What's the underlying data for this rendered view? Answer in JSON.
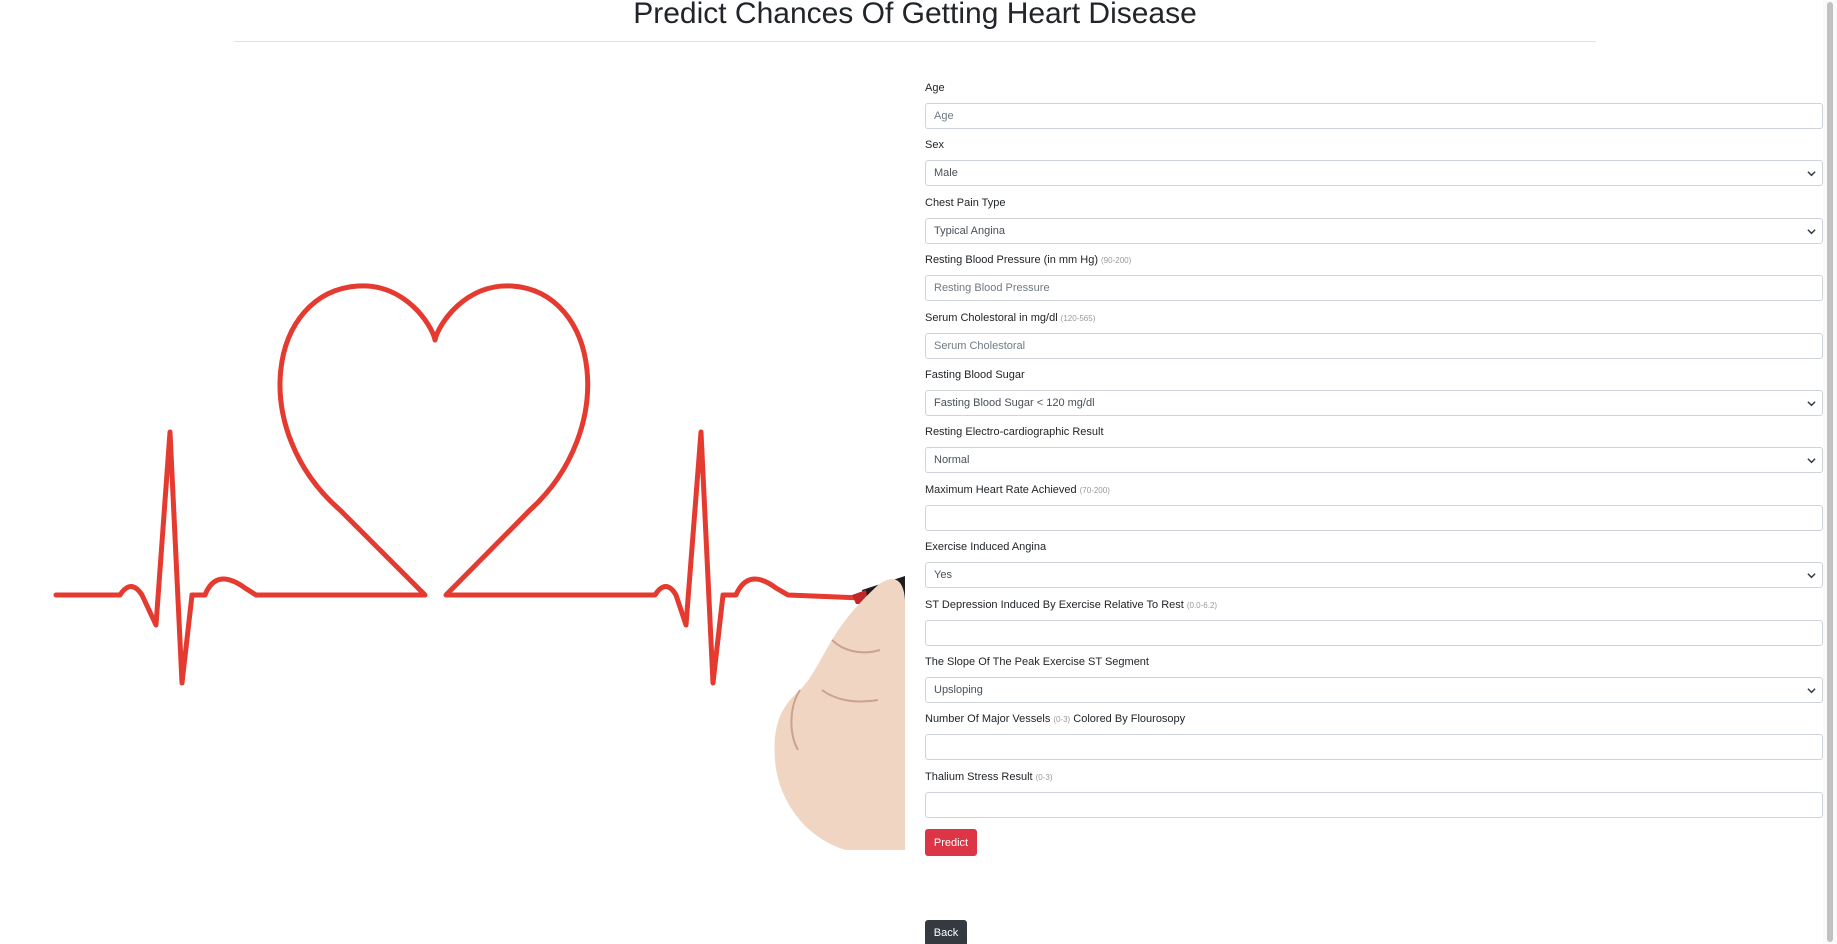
{
  "page": {
    "title": "Predict Chances Of Getting Heart Disease"
  },
  "form": {
    "fields": [
      {
        "label": "Age",
        "hint": "",
        "type": "input",
        "placeholder": "Age",
        "value": ""
      },
      {
        "label": "Sex",
        "hint": "",
        "type": "select",
        "value": "Male"
      },
      {
        "label": "Chest Pain Type",
        "hint": "",
        "type": "select",
        "value": "Typical Angina"
      },
      {
        "label": "Resting Blood Pressure (in mm Hg)",
        "hint": "(90-200)",
        "type": "input",
        "placeholder": "Resting Blood Pressure",
        "value": ""
      },
      {
        "label": "Serum Cholestoral in mg/dl",
        "hint": "(120-565)",
        "type": "input",
        "placeholder": "Serum Cholestoral",
        "value": ""
      },
      {
        "label": "Fasting Blood Sugar",
        "hint": "",
        "type": "select",
        "value": "Fasting Blood Sugar < 120 mg/dl"
      },
      {
        "label": "Resting Electro-cardiographic Result",
        "hint": "",
        "type": "select",
        "value": "Normal"
      },
      {
        "label": "Maximum Heart Rate Achieved",
        "hint": "(70-200)",
        "type": "input",
        "placeholder": "",
        "value": ""
      },
      {
        "label": "Exercise Induced Angina",
        "hint": "",
        "type": "select",
        "value": "Yes"
      },
      {
        "label": "ST Depression Induced By Exercise Relative To Rest",
        "hint": "(0.0-6.2)",
        "type": "input",
        "placeholder": "",
        "value": ""
      },
      {
        "label": "The Slope Of The Peak Exercise ST Segment",
        "hint": "",
        "type": "select",
        "value": "Upsloping"
      },
      {
        "label": "Number Of Major Vessels",
        "hint": "(0-3)",
        "label_suffix": "Colored By Flourosopy",
        "type": "input",
        "placeholder": "",
        "value": ""
      },
      {
        "label": "Thalium Stress Result",
        "hint": "(0-3)",
        "type": "input",
        "placeholder": "",
        "value": ""
      }
    ],
    "predict_label": "Predict",
    "back_label": "Back"
  },
  "colors": {
    "heart_line": "#e53a2f",
    "predict_button": "#dc3545",
    "back_button": "#343a40"
  },
  "icons": [
    "heart-ecg-illustration",
    "marker-pen-icon",
    "chevron-down-icon"
  ]
}
